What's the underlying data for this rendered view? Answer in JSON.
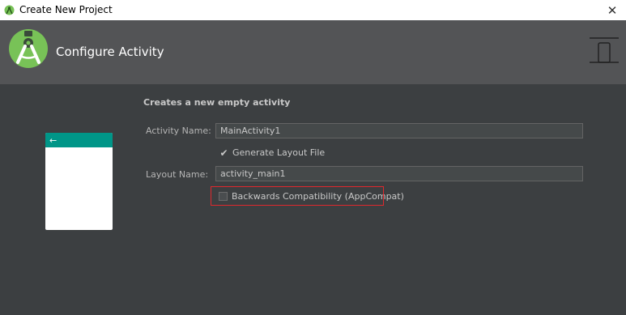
{
  "window": {
    "title": "Create New Project",
    "close_glyph": "✕"
  },
  "header": {
    "title": "Configure Activity",
    "logo_icon": "android-studio-logo-icon",
    "form_factor_icon": "phone-icon"
  },
  "preview": {
    "back_glyph": "←",
    "toolbar_color": "#009688"
  },
  "form": {
    "subtitle": "Creates a new empty activity",
    "activity_name_label": "Activity Name:",
    "activity_name_value": "MainActivity1",
    "generate_layout_label": "Generate Layout File",
    "generate_layout_checked": true,
    "layout_name_label": "Layout Name:",
    "layout_name_value": "activity_main1",
    "backwards_compat_label": "Backwards Compatibility (AppCompat)",
    "backwards_compat_checked": false
  },
  "colors": {
    "header_bg": "#535456",
    "body_bg": "#3c3f41",
    "highlight": "#e0282d"
  }
}
